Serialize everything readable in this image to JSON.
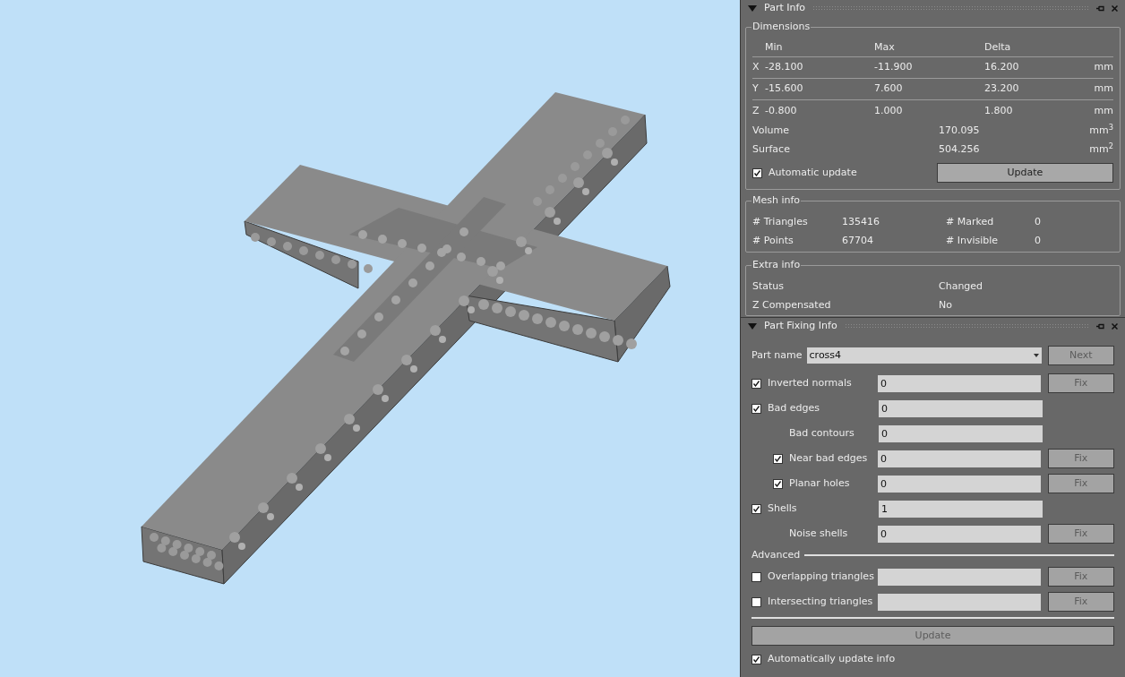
{
  "part_info": {
    "title": "Part Info",
    "dimensions": {
      "title": "Dimensions",
      "columns": [
        "Min",
        "Max",
        "Delta"
      ],
      "rows": [
        {
          "axis": "X",
          "min": "-28.100",
          "max": "-11.900",
          "delta": "16.200",
          "unit": "mm"
        },
        {
          "axis": "Y",
          "min": "-15.600",
          "max": "7.600",
          "delta": "23.200",
          "unit": "mm"
        },
        {
          "axis": "Z",
          "min": "-0.800",
          "max": "1.000",
          "delta": "1.800",
          "unit": "mm"
        }
      ],
      "totals": [
        {
          "label": "Volume",
          "value": "170.095",
          "unit": "mm$^{3}$"
        },
        {
          "label": "Surface",
          "value": "504.256",
          "unit": "mm$^{2}$"
        }
      ],
      "automatic_update": {
        "label": "Automatic update",
        "checked": true
      },
      "update_button": {
        "label": "Update",
        "disabled": false
      }
    },
    "mesh_info": {
      "title": "Mesh info",
      "items": [
        {
          "label": "# Triangles",
          "value": "135416"
        },
        {
          "label": "# Marked",
          "value": "0"
        },
        {
          "label": "# Points",
          "value": "67704"
        },
        {
          "label": "# Invisible",
          "value": "0"
        }
      ]
    },
    "extra_info": {
      "title": "Extra info",
      "items": [
        {
          "label": "Status",
          "value": "Changed"
        },
        {
          "label": "Z Compensated",
          "value": "No"
        }
      ]
    }
  },
  "part_fixing_info": {
    "title": "Part Fixing Info",
    "part_name": {
      "label": "Part name",
      "value": "cross4"
    },
    "next_button": {
      "label": "Next",
      "disabled": true
    },
    "checks": [
      {
        "kind": "checkbox",
        "label": "Inverted normals",
        "checked": true,
        "value": "0",
        "fix": {
          "label": "Fix",
          "disabled": true
        }
      },
      {
        "kind": "checkbox",
        "label": "Bad edges",
        "checked": true,
        "value": "0",
        "children": [
          {
            "kind": "plain",
            "label": "Bad contours",
            "value": "0"
          },
          {
            "kind": "checkbox",
            "label": "Near bad edges",
            "checked": true,
            "value": "0",
            "fix": {
              "label": "Fix",
              "disabled": true
            }
          },
          {
            "kind": "checkbox",
            "label": "Planar holes",
            "checked": true,
            "value": "0",
            "fix": {
              "label": "Fix",
              "disabled": true
            }
          }
        ]
      },
      {
        "kind": "checkbox",
        "label": "Shells",
        "checked": true,
        "value": "1",
        "children": [
          {
            "kind": "plain",
            "label": "Noise shells",
            "value": "0",
            "fix": {
              "label": "Fix",
              "disabled": true
            }
          }
        ]
      }
    ],
    "advanced": {
      "title": "Advanced",
      "checks": [
        {
          "kind": "checkbox",
          "label": "Overlapping triangles",
          "checked": false,
          "fix": {
            "label": "Fix",
            "disabled": true
          }
        },
        {
          "kind": "checkbox",
          "label": "Intersecting triangles",
          "checked": false,
          "fix": {
            "label": "Fix",
            "disabled": true
          }
        }
      ]
    },
    "update_button": {
      "label": "Update",
      "disabled": true
    },
    "auto_update": {
      "label": "Automatically update info",
      "checked": true
    }
  }
}
